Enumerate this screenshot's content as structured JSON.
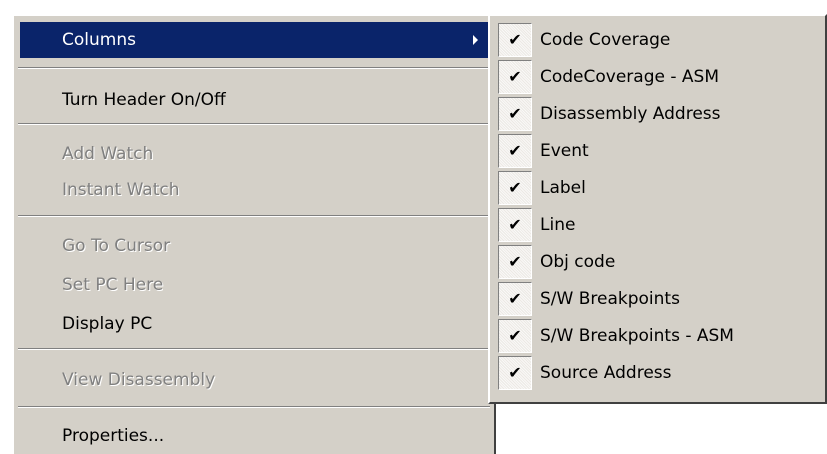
{
  "context_menu": {
    "items": [
      {
        "label": "Columns",
        "state": "highlighted",
        "has_submenu": true
      },
      {
        "label": "Turn Header On/Off",
        "state": "enabled"
      },
      {
        "label": "Add Watch",
        "state": "disabled"
      },
      {
        "label": "Instant Watch",
        "state": "disabled"
      },
      {
        "label": "Go To Cursor",
        "state": "disabled"
      },
      {
        "label": "Set PC Here",
        "state": "disabled"
      },
      {
        "label": "Display PC",
        "state": "enabled"
      },
      {
        "label": "View Disassembly",
        "state": "disabled"
      },
      {
        "label": "Properties...",
        "state": "enabled"
      }
    ]
  },
  "columns_submenu": {
    "check_glyph": "✔",
    "items": [
      {
        "label": "Code Coverage",
        "checked": true
      },
      {
        "label": "CodeCoverage - ASM",
        "checked": true
      },
      {
        "label": "Disassembly Address",
        "checked": true
      },
      {
        "label": "Event",
        "checked": true
      },
      {
        "label": "Label",
        "checked": true
      },
      {
        "label": "Line",
        "checked": true
      },
      {
        "label": "Obj code",
        "checked": true
      },
      {
        "label": "S/W Breakpoints",
        "checked": true
      },
      {
        "label": "S/W Breakpoints - ASM",
        "checked": true
      },
      {
        "label": "Source Address",
        "checked": true
      }
    ]
  },
  "colors": {
    "menu_face": "#d4d0c8",
    "highlight": "#0a246a",
    "disabled_text": "#808080"
  }
}
